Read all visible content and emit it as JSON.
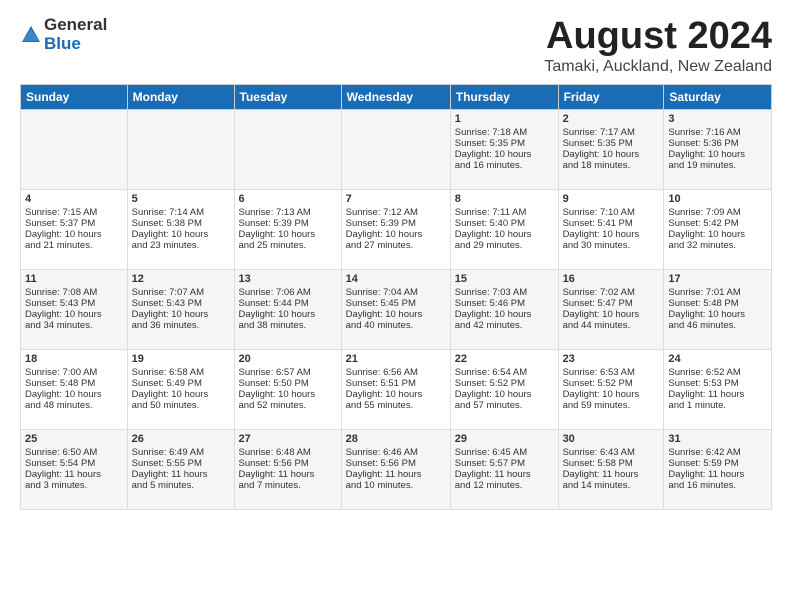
{
  "logo": {
    "general": "General",
    "blue": "Blue"
  },
  "title": "August 2024",
  "location": "Tamaki, Auckland, New Zealand",
  "weekdays": [
    "Sunday",
    "Monday",
    "Tuesday",
    "Wednesday",
    "Thursday",
    "Friday",
    "Saturday"
  ],
  "weeks": [
    [
      {
        "day": "",
        "content": ""
      },
      {
        "day": "",
        "content": ""
      },
      {
        "day": "",
        "content": ""
      },
      {
        "day": "",
        "content": ""
      },
      {
        "day": "1",
        "content": "Sunrise: 7:18 AM\nSunset: 5:35 PM\nDaylight: 10 hours\nand 16 minutes."
      },
      {
        "day": "2",
        "content": "Sunrise: 7:17 AM\nSunset: 5:35 PM\nDaylight: 10 hours\nand 18 minutes."
      },
      {
        "day": "3",
        "content": "Sunrise: 7:16 AM\nSunset: 5:36 PM\nDaylight: 10 hours\nand 19 minutes."
      }
    ],
    [
      {
        "day": "4",
        "content": "Sunrise: 7:15 AM\nSunset: 5:37 PM\nDaylight: 10 hours\nand 21 minutes."
      },
      {
        "day": "5",
        "content": "Sunrise: 7:14 AM\nSunset: 5:38 PM\nDaylight: 10 hours\nand 23 minutes."
      },
      {
        "day": "6",
        "content": "Sunrise: 7:13 AM\nSunset: 5:39 PM\nDaylight: 10 hours\nand 25 minutes."
      },
      {
        "day": "7",
        "content": "Sunrise: 7:12 AM\nSunset: 5:39 PM\nDaylight: 10 hours\nand 27 minutes."
      },
      {
        "day": "8",
        "content": "Sunrise: 7:11 AM\nSunset: 5:40 PM\nDaylight: 10 hours\nand 29 minutes."
      },
      {
        "day": "9",
        "content": "Sunrise: 7:10 AM\nSunset: 5:41 PM\nDaylight: 10 hours\nand 30 minutes."
      },
      {
        "day": "10",
        "content": "Sunrise: 7:09 AM\nSunset: 5:42 PM\nDaylight: 10 hours\nand 32 minutes."
      }
    ],
    [
      {
        "day": "11",
        "content": "Sunrise: 7:08 AM\nSunset: 5:43 PM\nDaylight: 10 hours\nand 34 minutes."
      },
      {
        "day": "12",
        "content": "Sunrise: 7:07 AM\nSunset: 5:43 PM\nDaylight: 10 hours\nand 36 minutes."
      },
      {
        "day": "13",
        "content": "Sunrise: 7:06 AM\nSunset: 5:44 PM\nDaylight: 10 hours\nand 38 minutes."
      },
      {
        "day": "14",
        "content": "Sunrise: 7:04 AM\nSunset: 5:45 PM\nDaylight: 10 hours\nand 40 minutes."
      },
      {
        "day": "15",
        "content": "Sunrise: 7:03 AM\nSunset: 5:46 PM\nDaylight: 10 hours\nand 42 minutes."
      },
      {
        "day": "16",
        "content": "Sunrise: 7:02 AM\nSunset: 5:47 PM\nDaylight: 10 hours\nand 44 minutes."
      },
      {
        "day": "17",
        "content": "Sunrise: 7:01 AM\nSunset: 5:48 PM\nDaylight: 10 hours\nand 46 minutes."
      }
    ],
    [
      {
        "day": "18",
        "content": "Sunrise: 7:00 AM\nSunset: 5:48 PM\nDaylight: 10 hours\nand 48 minutes."
      },
      {
        "day": "19",
        "content": "Sunrise: 6:58 AM\nSunset: 5:49 PM\nDaylight: 10 hours\nand 50 minutes."
      },
      {
        "day": "20",
        "content": "Sunrise: 6:57 AM\nSunset: 5:50 PM\nDaylight: 10 hours\nand 52 minutes."
      },
      {
        "day": "21",
        "content": "Sunrise: 6:56 AM\nSunset: 5:51 PM\nDaylight: 10 hours\nand 55 minutes."
      },
      {
        "day": "22",
        "content": "Sunrise: 6:54 AM\nSunset: 5:52 PM\nDaylight: 10 hours\nand 57 minutes."
      },
      {
        "day": "23",
        "content": "Sunrise: 6:53 AM\nSunset: 5:52 PM\nDaylight: 10 hours\nand 59 minutes."
      },
      {
        "day": "24",
        "content": "Sunrise: 6:52 AM\nSunset: 5:53 PM\nDaylight: 11 hours\nand 1 minute."
      }
    ],
    [
      {
        "day": "25",
        "content": "Sunrise: 6:50 AM\nSunset: 5:54 PM\nDaylight: 11 hours\nand 3 minutes."
      },
      {
        "day": "26",
        "content": "Sunrise: 6:49 AM\nSunset: 5:55 PM\nDaylight: 11 hours\nand 5 minutes."
      },
      {
        "day": "27",
        "content": "Sunrise: 6:48 AM\nSunset: 5:56 PM\nDaylight: 11 hours\nand 7 minutes."
      },
      {
        "day": "28",
        "content": "Sunrise: 6:46 AM\nSunset: 5:56 PM\nDaylight: 11 hours\nand 10 minutes."
      },
      {
        "day": "29",
        "content": "Sunrise: 6:45 AM\nSunset: 5:57 PM\nDaylight: 11 hours\nand 12 minutes."
      },
      {
        "day": "30",
        "content": "Sunrise: 6:43 AM\nSunset: 5:58 PM\nDaylight: 11 hours\nand 14 minutes."
      },
      {
        "day": "31",
        "content": "Sunrise: 6:42 AM\nSunset: 5:59 PM\nDaylight: 11 hours\nand 16 minutes."
      }
    ]
  ]
}
